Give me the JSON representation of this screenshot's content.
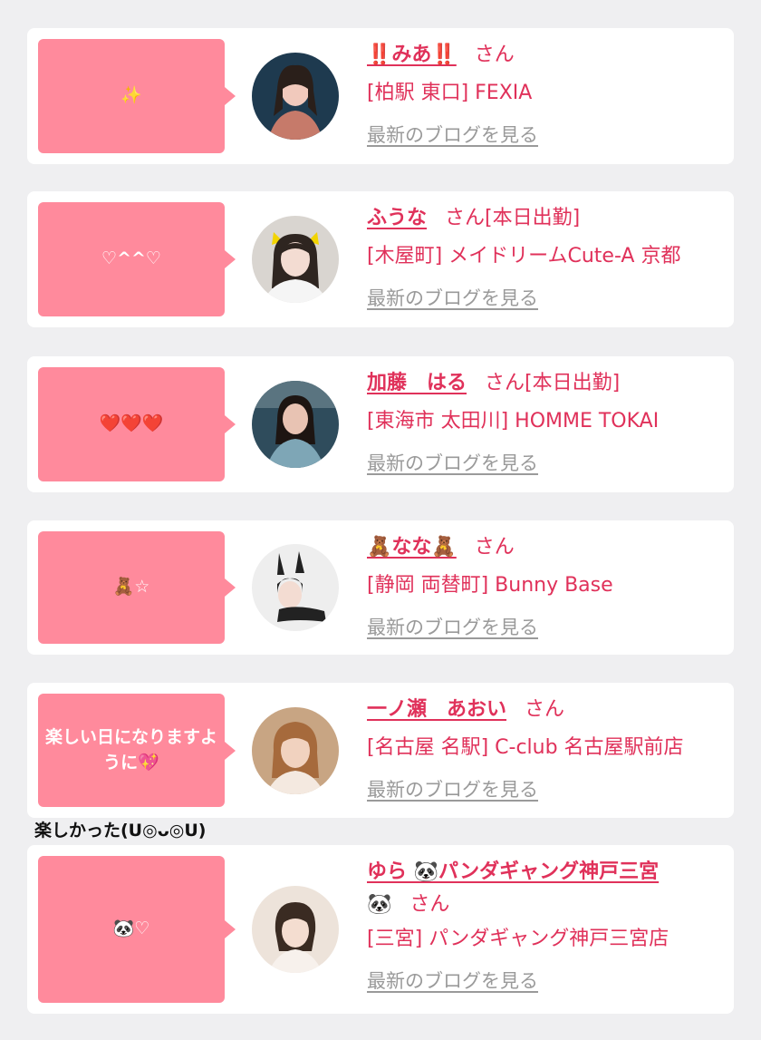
{
  "entries": [
    {
      "bubble_text": "✨",
      "name": "‼️みあ‼️",
      "san": "さん",
      "badge": "",
      "shop": "[柏駅 東口] FEXIA",
      "blog_link": "最新のブログを見る",
      "avatar_colors": [
        "#1e3a4f",
        "#f1c9bc"
      ]
    },
    {
      "bubble_text": "♡^^♡",
      "name": "ふうな",
      "san": "さん",
      "badge": "[本日出勤]",
      "shop": "[木屋町] メイドリームCute-A 京都",
      "blog_link": "最新のブログを見る",
      "avatar_colors": [
        "#d9d5d0",
        "#f3dcd2"
      ]
    },
    {
      "bubble_text": "❤️❤️❤️",
      "name": "加藤　はる",
      "san": "さん",
      "badge": "[本日出勤]",
      "shop": "[東海市 太田川] HOMME TOKAI",
      "blog_link": "最新のブログを見る",
      "avatar_colors": [
        "#2f4c5c",
        "#e8c3b3"
      ]
    },
    {
      "bubble_text": "🧸☆",
      "name": "🧸なな🧸",
      "san": "さん",
      "badge": "",
      "shop": "[静岡 両替町] Bunny Base",
      "blog_link": "最新のブログを見る",
      "avatar_colors": [
        "#eeeeee",
        "#222222"
      ]
    },
    {
      "bubble_text": "楽しい日になりますように💖",
      "name": "一ノ瀬　あおい",
      "san": "さん",
      "badge": "",
      "shop": "[名古屋 名駅] C-club 名古屋駅前店",
      "blog_link": "最新のブログを見る",
      "avatar_colors": [
        "#c8a583",
        "#f1d2bf"
      ]
    },
    {
      "bubble_text": "🐼♡",
      "name": "ゆら 🐼パンダギャング神戸三宮",
      "name_suffix": "🐼",
      "san": "さん",
      "badge": "",
      "shop": "[三宮] パンダギャング神戸三宮店",
      "blog_link": "最新のブログを見る",
      "avatar_colors": [
        "#ede3da",
        "#3a2b22"
      ]
    }
  ],
  "between_text": "楽しかった(U◎ᴗ◎U)",
  "colors": {
    "bubble": "#ff8a9c",
    "accent": "#e0315a",
    "link_gray": "#9a9a9a",
    "page_bg": "#efeff1"
  }
}
